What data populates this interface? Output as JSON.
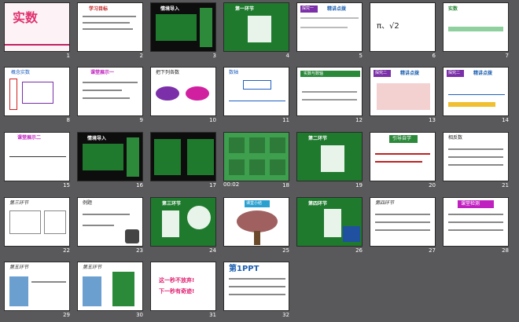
{
  "slides": [
    {
      "num": "1",
      "title": "实数"
    },
    {
      "num": "2",
      "title": "学习目标"
    },
    {
      "num": "3",
      "title": "情境导入"
    },
    {
      "num": "4",
      "title": "第一环节"
    },
    {
      "num": "5",
      "title": "探究一",
      "tag": "精讲点拨"
    },
    {
      "num": "6",
      "title": "π、√2"
    },
    {
      "num": "7",
      "title": "实数"
    },
    {
      "num": "8",
      "title": "概念实数"
    },
    {
      "num": "9",
      "title": "课堂展示一"
    },
    {
      "num": "10",
      "title": "把下列各数"
    },
    {
      "num": "11",
      "title": "数轴"
    },
    {
      "num": "12",
      "title": "实数与数轴"
    },
    {
      "num": "13",
      "title": "探究二",
      "tag": "精讲点拨"
    },
    {
      "num": "14",
      "title": "探究二",
      "tag": "精讲点拨"
    },
    {
      "num": "15",
      "title": "课堂展示二"
    },
    {
      "num": "16",
      "title": "情境导入"
    },
    {
      "num": "17",
      "title": ""
    },
    {
      "num": "18",
      "timer": "00:02"
    },
    {
      "num": "19",
      "title": "第二环节"
    },
    {
      "num": "20",
      "title": "引导自学"
    },
    {
      "num": "21",
      "title": "相反数"
    },
    {
      "num": "22",
      "title": "第三环节"
    },
    {
      "num": "23",
      "title": "例题"
    },
    {
      "num": "24",
      "title": "第三环节"
    },
    {
      "num": "25",
      "title": "课堂小结"
    },
    {
      "num": "26",
      "title": "第四环节"
    },
    {
      "num": "27",
      "title": "第四环节"
    },
    {
      "num": "28",
      "title": "课堂检测"
    },
    {
      "num": "29",
      "title": "第五环节"
    },
    {
      "num": "30",
      "title": "第五环节"
    },
    {
      "num": "31",
      "line1": "这一秒不放弃!",
      "line2": "下一秒有奇迹!"
    },
    {
      "num": "32",
      "title": "第1PPT"
    }
  ],
  "colors": {
    "background": "#59595b",
    "slide_green": "#1f7a2e",
    "accent_red": "#e03030",
    "accent_purple": "#7b2fa8"
  }
}
